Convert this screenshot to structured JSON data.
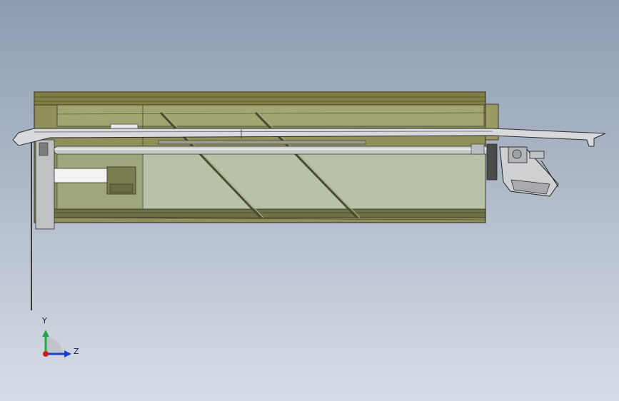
{
  "view": {
    "background_top": "#8c9cb1",
    "background_bottom": "#d7dde6"
  },
  "model": {
    "housing_color": "#8f8f5a",
    "glass_color": "#b7c2a6",
    "frame_color": "#d8d9dc",
    "rod_color": "#c9cccd",
    "edge_color": "#3a3a2a"
  },
  "triad": {
    "y_label": "Y",
    "z_label": "Z",
    "y_color": "#2aa44a",
    "z_color": "#1f3fd0",
    "x_color": "#d11c1c"
  }
}
